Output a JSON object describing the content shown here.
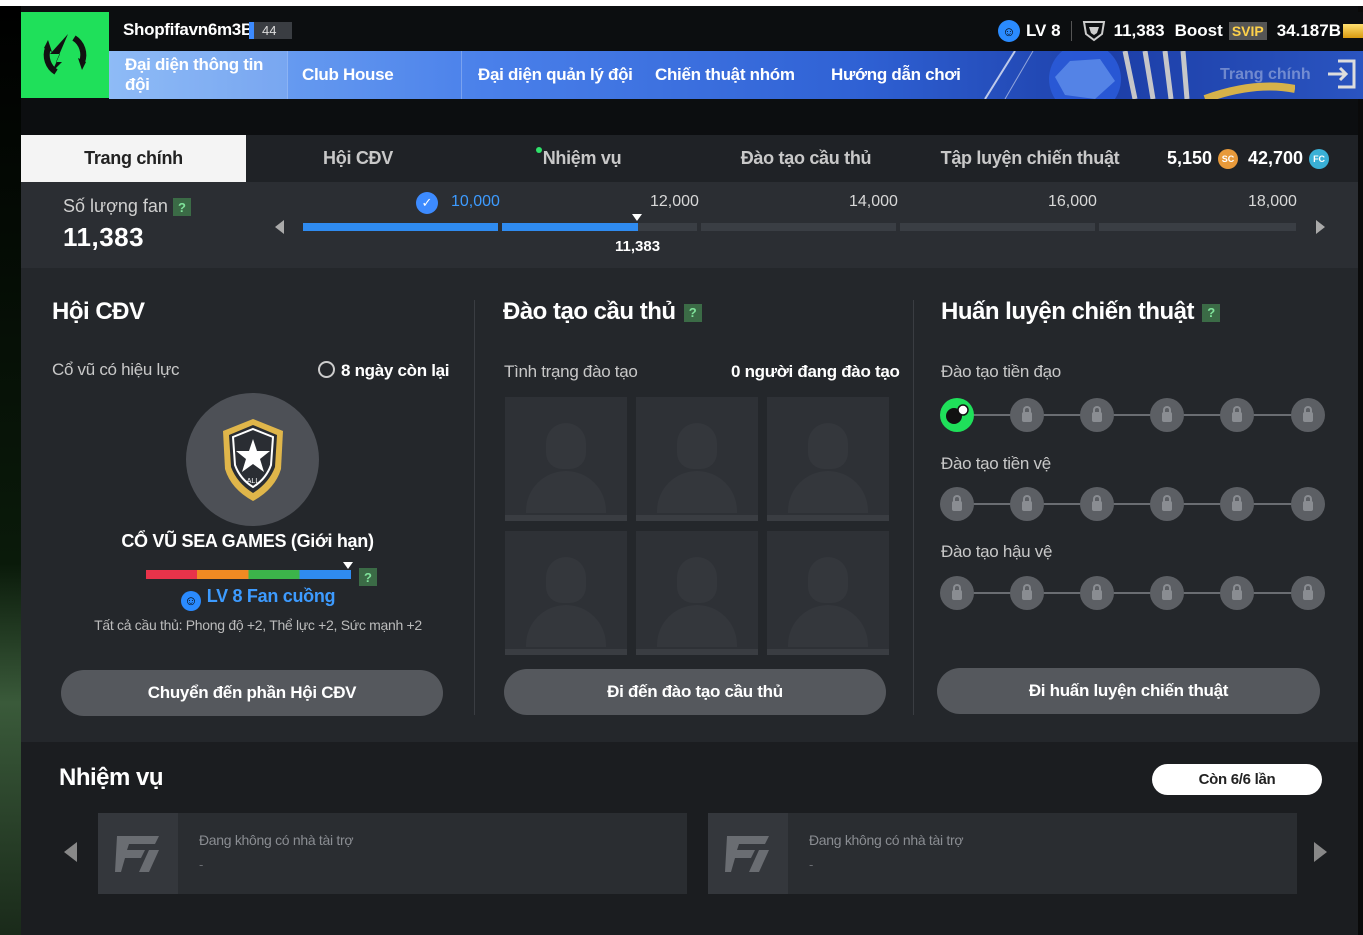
{
  "header": {
    "club_name": "Shopfifavn6m3B",
    "club_level": "44",
    "account_level": "LV 8",
    "fans": "11,383",
    "boost_label": "Boost",
    "svip_label": "SVIP",
    "balance": "34.187B"
  },
  "nav": {
    "items": [
      {
        "label": "Đại diện thông tin đội"
      },
      {
        "label": "Club House"
      },
      {
        "label": "Đại diện quản lý đội"
      },
      {
        "label": "Chiến thuật nhóm"
      },
      {
        "label": "Hướng dẫn chơi"
      }
    ],
    "faded_label": "Trang chính"
  },
  "tabs": [
    {
      "label": "Trang chính"
    },
    {
      "label": "Hội CĐV"
    },
    {
      "label": "Nhiệm vụ"
    },
    {
      "label": "Đào tạo cầu thủ"
    },
    {
      "label": "Tập luyện chiến thuật"
    }
  ],
  "currency": {
    "sc_value": "5,150",
    "sc_label": "SC",
    "fc_value": "42,700",
    "fc_label": "FC"
  },
  "fan_progress": {
    "label": "Số lượng fan",
    "count": "11,383",
    "milestones": [
      "10,000",
      "12,000",
      "14,000",
      "16,000",
      "18,000"
    ],
    "current_value": "11,383",
    "current": 11383,
    "range": [
      8000,
      18000
    ]
  },
  "supporters": {
    "title": "Hội CĐV",
    "active_label": "Cổ vũ có hiệu lực",
    "time_left": "8 ngày còn lại",
    "badge_text": "ALL",
    "cheer_name": "CỔ VŨ SEA GAMES (Giới hạn)",
    "fan_level": "LV 8 Fan cuồng",
    "buff": "Tất cả cầu thủ: Phong độ +2, Thể lực +2, Sức mạnh +2",
    "button": "Chuyển đến phần Hội CĐV"
  },
  "player_training": {
    "title": "Đào tạo cầu thủ",
    "status_label": "Tình trạng đào tạo",
    "status_value": "0 người đang đào tạo",
    "button": "Đi đến đào tạo cầu thủ"
  },
  "tactical_training": {
    "title": "Huấn luyện chiến thuật",
    "rows": [
      {
        "label": "Đào tạo tiền đạo"
      },
      {
        "label": "Đào tạo tiền vệ"
      },
      {
        "label": "Đào tạo hậu vệ"
      }
    ],
    "button": "Đi huấn luyện chiến thuật"
  },
  "missions": {
    "title": "Nhiệm vụ",
    "remaining": "Còn 6/6 lần",
    "cards": [
      {
        "text": "Đang không có nhà tài trợ",
        "sub": "-"
      },
      {
        "text": "Đang không có nhà tài trợ",
        "sub": "-"
      }
    ]
  },
  "colors": {
    "accent_green": "#1fe05a",
    "accent_blue": "#2f8bf0",
    "panel": "#24272b"
  }
}
